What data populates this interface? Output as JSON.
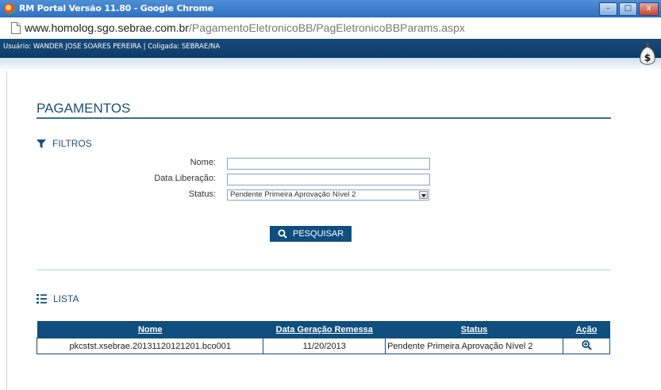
{
  "window": {
    "title": "RM Portal Versão 11.80 - Google Chrome",
    "minimize": "–",
    "maximize": "□",
    "close": "x"
  },
  "address": {
    "host": "www.homolog.sgo.sebrae.com.br",
    "path": "/PagamentoEletronicoBB/PagEletronicoBBParams.aspx"
  },
  "header": {
    "user_info": "Usuário: WANDER JOSE SOARES PEREIRA | Coligada: SEBRAE/NA"
  },
  "page": {
    "title": "PAGAMENTOS"
  },
  "filters": {
    "heading": "FILTROS",
    "nome_label": "Nome:",
    "nome_value": "",
    "data_label": "Data Liberação:",
    "data_value": "",
    "status_label": "Status:",
    "status_value": "Pendente Primeira Aprovação Nível 2",
    "search_button": "PESQUISAR"
  },
  "list": {
    "heading": "LISTA",
    "columns": [
      "Nome",
      "Data Geração Remessa",
      "Status",
      "Ação"
    ],
    "rows": [
      {
        "nome": "pkcstst.xsebrae.20131120121201.bco001",
        "data": "11/20/2013",
        "status": "Pendente Primeira Aprovação Nível 2",
        "acao_icon": "zoom-in-icon"
      }
    ]
  },
  "colors": {
    "primary": "#0f4e7e",
    "title_text": "#1a4f78"
  }
}
